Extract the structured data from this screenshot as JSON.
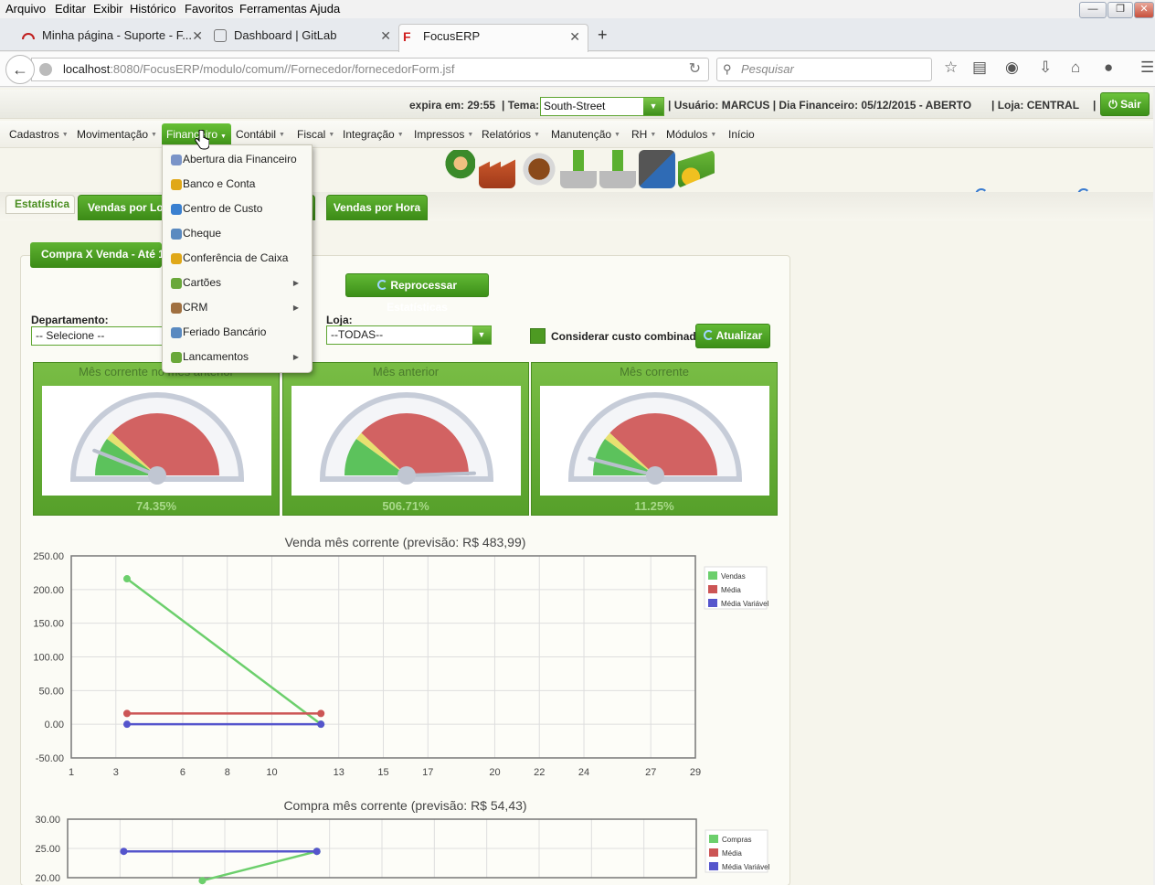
{
  "browser": {
    "menus": [
      "Arquivo",
      "Editar",
      "Exibir",
      "Histórico",
      "Favoritos",
      "Ferramentas",
      "Ajuda"
    ],
    "tabs": [
      {
        "title": "Minha página - Suporte - F..."
      },
      {
        "title": "Dashboard | GitLab"
      },
      {
        "title": "FocusERP"
      }
    ],
    "url_host": "localhost",
    "url_rest": ":8080/FocusERP/modulo/comum//Fornecedor/fornecedorForm.jsf",
    "search_placeholder": "Pesquisar"
  },
  "header": {
    "expira": "expira em: 29:55",
    "tema_label": "| Tema:",
    "tema_value": "South-Street",
    "usuario": "| Usuário: MARCUS | Dia Financeiro: 05/12/2015 - ABERTO",
    "loja": "| Loja: CENTRAL",
    "sep": "|",
    "sair": "Sair"
  },
  "menu": {
    "items": [
      "Cadastros",
      "Movimentação",
      "Financeiro",
      "Contábil",
      "Fiscal",
      "Integração",
      "Impressos",
      "Relatórios",
      "Manutenção",
      "RH",
      "Módulos",
      "Início"
    ]
  },
  "dropdown": {
    "items": [
      {
        "label": "Abertura dia Financeiro",
        "icon": "calendar-icon",
        "color": "#7a94c8"
      },
      {
        "label": "Banco e Conta",
        "icon": "coin-icon",
        "color": "#e0a818"
      },
      {
        "label": "Centro de Custo",
        "icon": "pie-icon",
        "color": "#3a80d0"
      },
      {
        "label": "Cheque",
        "icon": "cheque-icon",
        "color": "#5a8ac0"
      },
      {
        "label": "Conferência de Caixa",
        "icon": "coin-icon",
        "color": "#e0a818"
      },
      {
        "label": "Cartões",
        "icon": "cards-icon",
        "color": "#6aa83a",
        "submenu": true
      },
      {
        "label": "CRM",
        "icon": "person-icon",
        "color": "#a07040",
        "submenu": true
      },
      {
        "label": "Feriado Bancário",
        "icon": "cheque-icon",
        "color": "#5a8ac0"
      },
      {
        "label": "Lancamentos",
        "icon": "cards-icon",
        "color": "#6aa83a",
        "submenu": true
      }
    ]
  },
  "tabs": [
    "Estatística",
    "Vendas por Loja",
    "Vendas por Hora"
  ],
  "panel": {
    "tab": "Compra X Venda - Até 13/",
    "reprocess": "Reprocessar Estatísticas",
    "depto_label": "Departamento:",
    "depto_value": "-- Selecione --",
    "loja_label": "Loja:",
    "loja_value": "--TODAS--",
    "custo_label": "Considerar custo combinado",
    "atualizar": "Atualizar"
  },
  "gauges": [
    {
      "title": "Mês corrente no mês anterior",
      "value": "74.35%",
      "fraction": 0.12
    },
    {
      "title": "Mês anterior",
      "value": "506.71%",
      "fraction": 0.99
    },
    {
      "title": "Mês corrente",
      "value": "11.25%",
      "fraction": 0.08
    }
  ],
  "colors": {
    "green": "#4d9a22",
    "vendas": "#6ccf6c",
    "media": "#cc5555",
    "media_var": "#5555cc"
  },
  "chart_data": [
    {
      "type": "line",
      "title": "Venda mês corrente (previsão: R$ 483,99)",
      "x_ticks": [
        1,
        3,
        6,
        8,
        10,
        13,
        15,
        17,
        20,
        22,
        24,
        27,
        29
      ],
      "y_ticks": [
        "250.00",
        "200.00",
        "150.00",
        "100.00",
        "50.00",
        "0.00",
        "-50.00"
      ],
      "ylim": [
        -50,
        250
      ],
      "legend_position": "top-right",
      "series": [
        {
          "name": "Vendas",
          "x": [
            3.5,
            12.2
          ],
          "y": [
            216,
            0
          ]
        },
        {
          "name": "Média",
          "x": [
            3.5,
            12.2
          ],
          "y": [
            16,
            16
          ]
        },
        {
          "name": "Média Variável",
          "x": [
            3.5,
            12.2
          ],
          "y": [
            0,
            0
          ]
        }
      ]
    },
    {
      "type": "line",
      "title": "Compra mês corrente (previsão: R$ 54,43)",
      "y_ticks": [
        "30.00",
        "25.00",
        "20.00"
      ],
      "ylim": [
        20,
        30
      ],
      "legend_position": "top-right",
      "series": [
        {
          "name": "Compras",
          "x": [
            7,
            12.1
          ],
          "y": [
            19.5,
            24.5
          ]
        },
        {
          "name": "Média",
          "x": [],
          "y": []
        },
        {
          "name": "Média Variável",
          "x": [
            3.5,
            12.1
          ],
          "y": [
            24.5,
            24.5
          ]
        }
      ]
    }
  ]
}
